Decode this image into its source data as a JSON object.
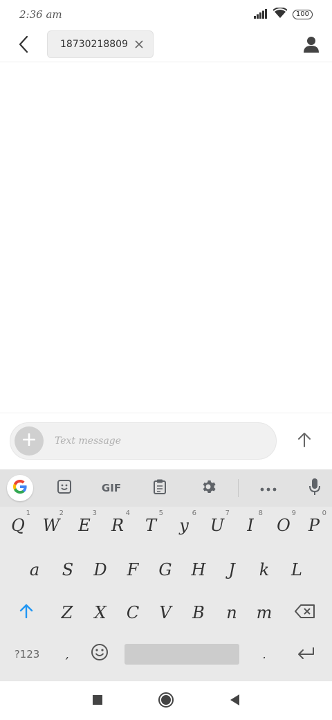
{
  "status_bar": {
    "time": "2:36 am",
    "battery": "100"
  },
  "header": {
    "recipient": "18730218809"
  },
  "compose": {
    "placeholder": "Text message"
  },
  "keyboard": {
    "toolbar": {
      "gif_label": "GIF"
    },
    "row1": [
      {
        "label": "Q",
        "hint": "1"
      },
      {
        "label": "W",
        "hint": "2"
      },
      {
        "label": "E",
        "hint": "3"
      },
      {
        "label": "R",
        "hint": "4"
      },
      {
        "label": "T",
        "hint": "5"
      },
      {
        "label": "y",
        "hint": "6"
      },
      {
        "label": "U",
        "hint": "7"
      },
      {
        "label": "I",
        "hint": "8"
      },
      {
        "label": "O",
        "hint": "9"
      },
      {
        "label": "P",
        "hint": "0"
      }
    ],
    "row2": [
      "a",
      "S",
      "D",
      "F",
      "G",
      "H",
      "J",
      "k",
      "L"
    ],
    "row3": [
      "Z",
      "X",
      "C",
      "V",
      "B",
      "n",
      "m"
    ],
    "row4": {
      "symbols_label": "?123",
      "comma": ",",
      "period": "."
    }
  },
  "colors": {
    "accent_blue": "#2196f3",
    "keyboard_bg": "#e9e9e9",
    "toolbar_bg": "#e2e2e2"
  }
}
